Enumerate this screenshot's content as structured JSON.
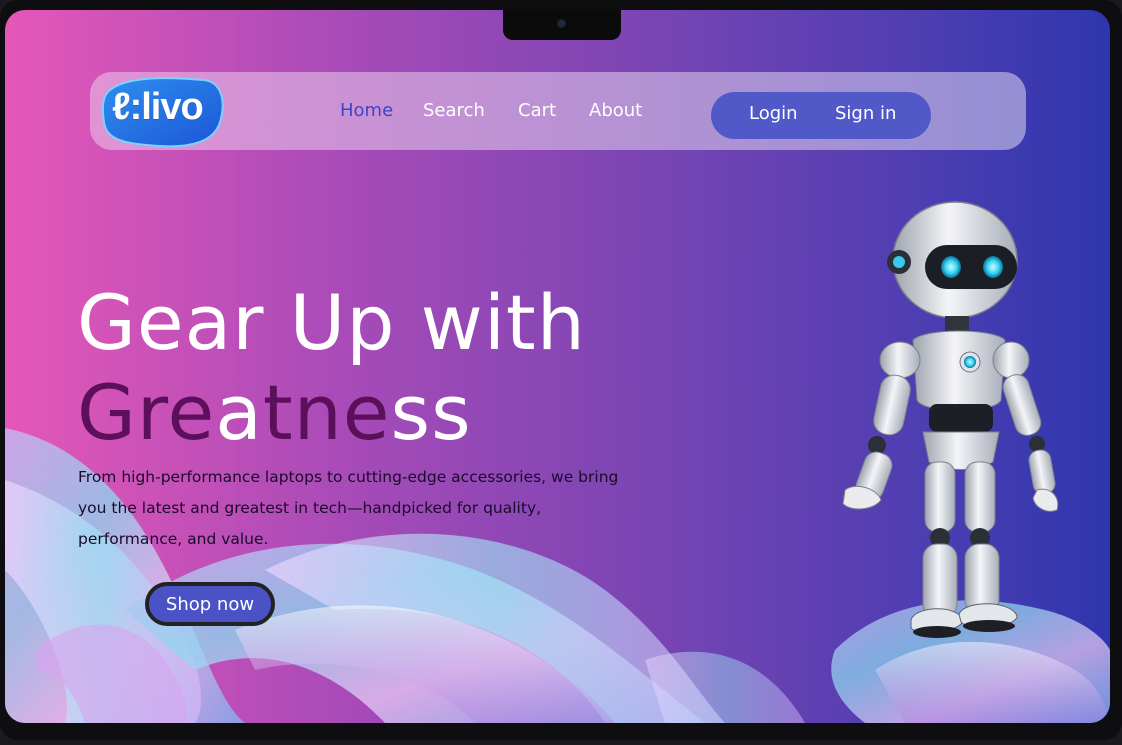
{
  "brand": {
    "name": "Elivo",
    "logo_text": "ℓ:livo"
  },
  "nav": {
    "links": [
      {
        "label": "Home",
        "active": true
      },
      {
        "label": "Search",
        "active": false
      },
      {
        "label": "Cart",
        "active": false
      },
      {
        "label": "About",
        "active": false
      }
    ],
    "login_label": "Login",
    "signin_label": "Sign in"
  },
  "hero": {
    "title_line1": "Gear Up with",
    "title_line2_dark_a": "Gre",
    "title_line2_light_a": "a",
    "title_line2_dark_b": "tne",
    "title_line2_light_b": "ss",
    "description": "From high-performance laptops to cutting-edge accessories, we bring you the latest and greatest in tech—handpicked for quality, performance, and value.",
    "cta_label": "Shop now"
  },
  "colors": {
    "gradient_start": "#e557b8",
    "gradient_end": "#2e36ad",
    "accent": "#4a52c6",
    "title_dark": "#5c0f5a"
  },
  "icons": {
    "robot": "robot-illustration",
    "ribbons": "glass-ribbon-decoration"
  }
}
